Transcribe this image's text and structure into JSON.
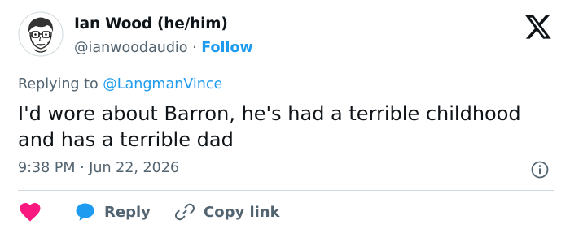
{
  "author": {
    "display_name": "Ian Wood (he/him)",
    "handle": "@ianwoodaudio",
    "separator": "·",
    "follow_label": "Follow"
  },
  "reply_context": {
    "prefix": "Replying to",
    "mention": "@LangmanVince"
  },
  "tweet": {
    "text": "I'd wore about Barron, he's had a terrible childhood and has a terrible dad",
    "time": "9:38 PM",
    "separator": "·",
    "date": "Jun 22, 2026"
  },
  "actions": {
    "reply_label": "Reply",
    "copy_link_label": "Copy link"
  },
  "icons": {
    "avatar": "avatar-cartoon-face",
    "logo": "x-logo-icon",
    "info": "info-icon",
    "like": "heart-icon",
    "reply": "speech-bubble-icon",
    "copy": "link-icon"
  },
  "colors": {
    "accent": "#1d9bf0",
    "heart": "#f91880",
    "muted_text": "#536471",
    "divider": "#cfd9de"
  }
}
